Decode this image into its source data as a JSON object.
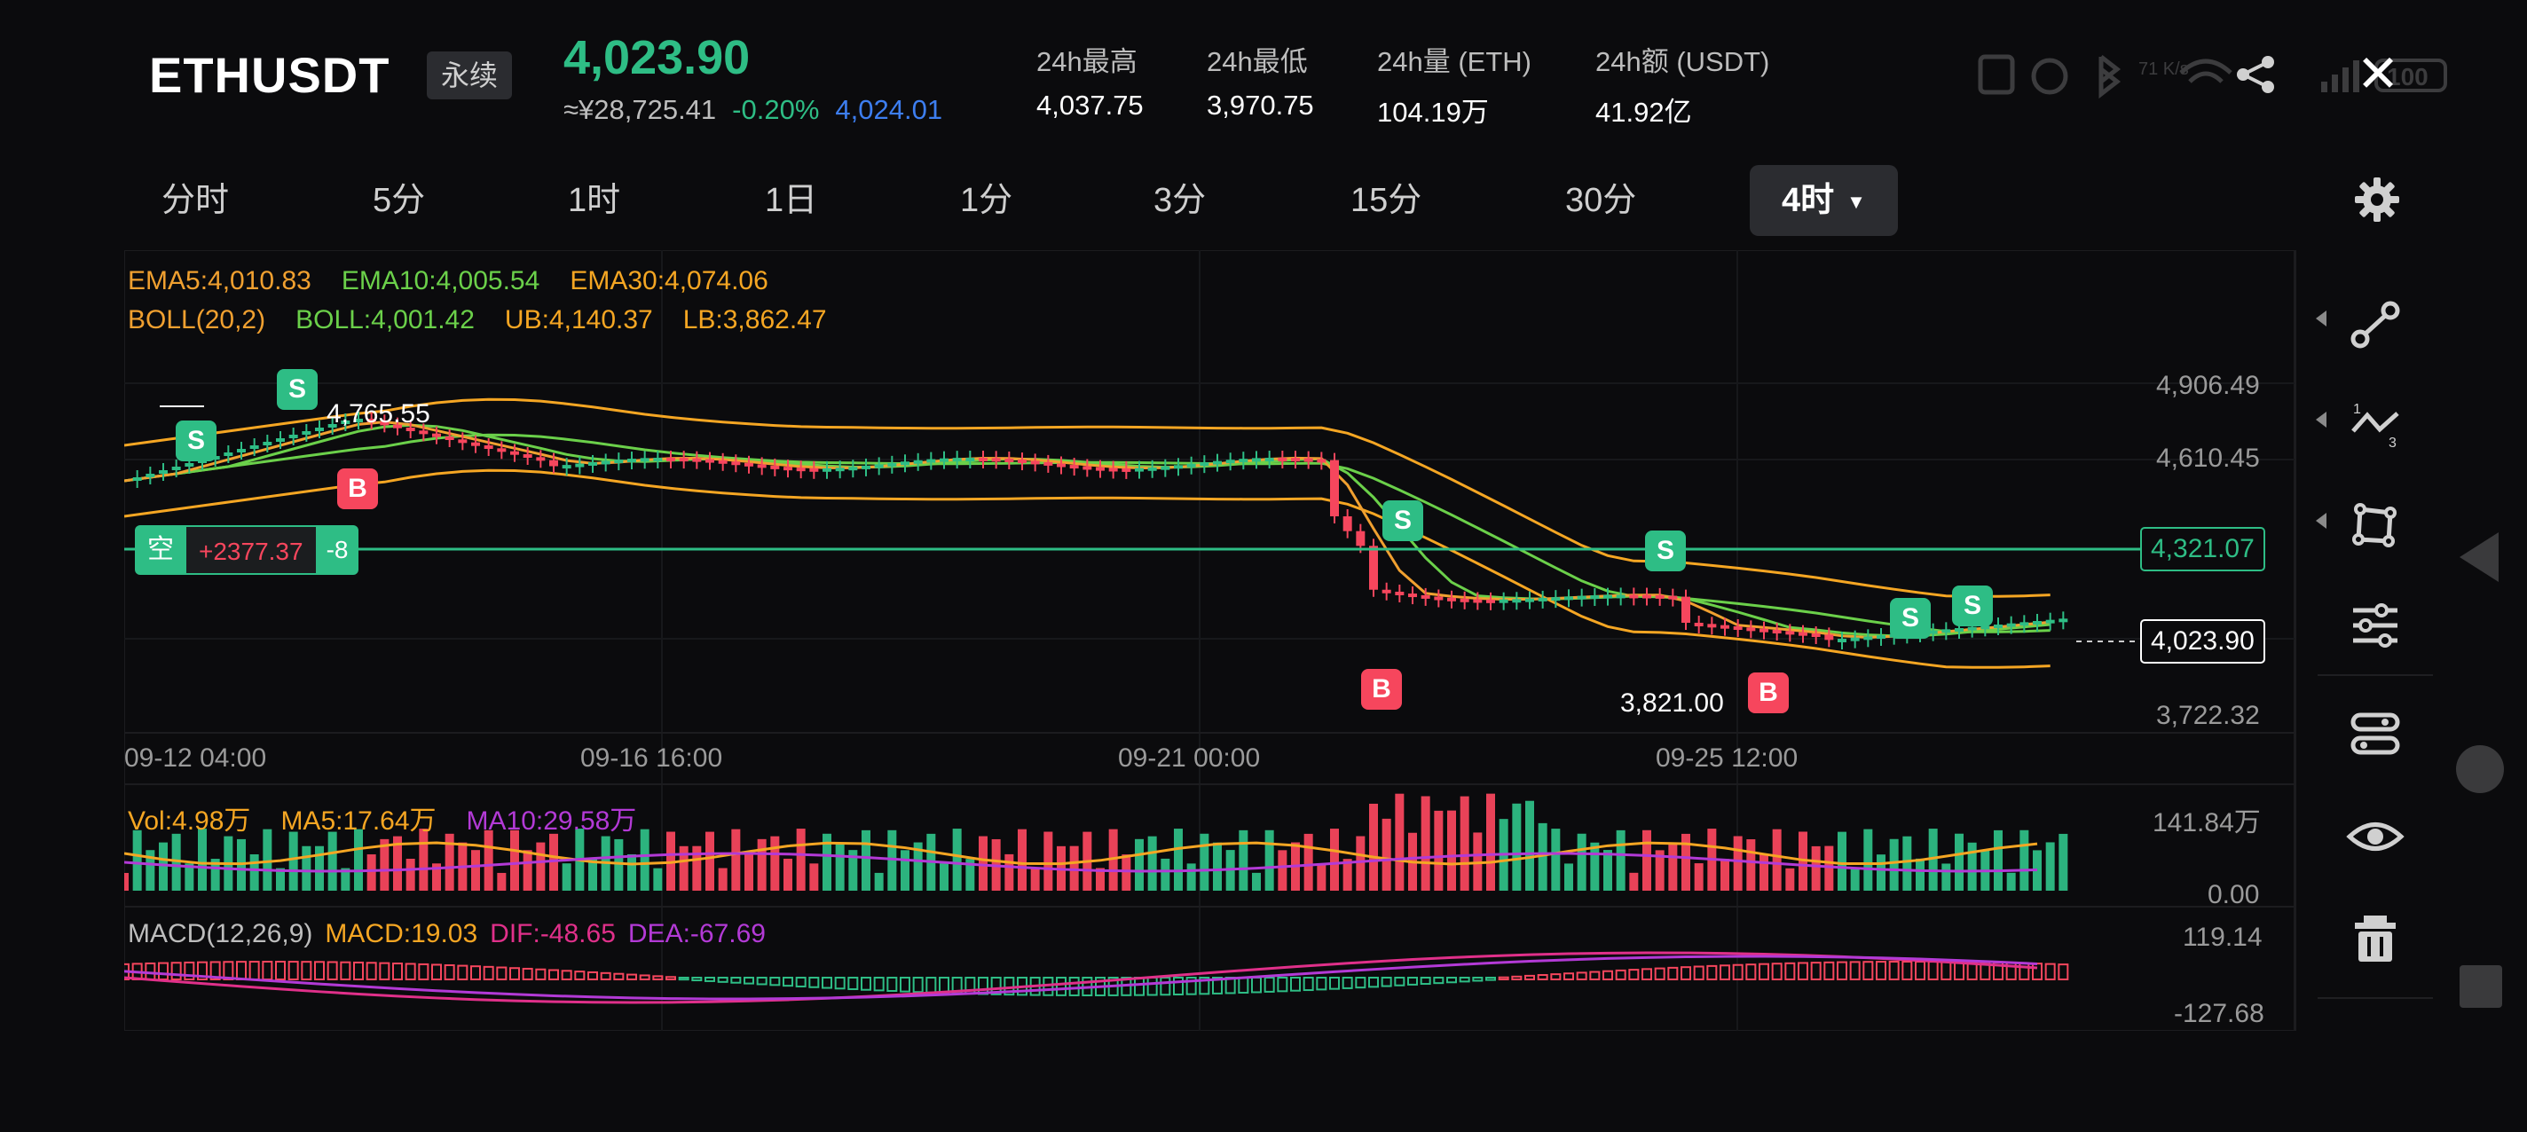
{
  "header": {
    "symbol": "ETHUSDT",
    "contract_type": "永续",
    "last_price": "4,023.90",
    "cny_price": "≈¥28,725.41",
    "change_pct": "-0.20%",
    "mark_price": "4,024.01",
    "stats": [
      {
        "label": "24h最高",
        "value": "4,037.75"
      },
      {
        "label": "24h最低",
        "value": "3,970.75"
      },
      {
        "label": "24h量 (ETH)",
        "value": "104.19万"
      },
      {
        "label": "24h额 (USDT)",
        "value": "41.92亿"
      }
    ],
    "status_icons": [
      "nfc-icon",
      "alarm-icon",
      "bluetooth-icon",
      "network-speed-icon",
      "wifi-icon",
      "signal-icon",
      "battery-icon"
    ],
    "network_speed": "71 K/s",
    "battery_level": "100"
  },
  "intervals": [
    {
      "label": "分时"
    },
    {
      "label": "5分"
    },
    {
      "label": "1时"
    },
    {
      "label": "1日"
    },
    {
      "label": "1分"
    },
    {
      "label": "3分"
    },
    {
      "label": "15分"
    },
    {
      "label": "30分"
    },
    {
      "label": "4时",
      "active": true
    }
  ],
  "legend": {
    "ema5": "EMA5:4,010.83",
    "ema10": "EMA10:4,005.54",
    "ema30": "EMA30:4,074.06",
    "boll_param": "BOLL(20,2)",
    "boll": "BOLL:4,001.42",
    "ub": "UB:4,140.37",
    "lb": "LB:3,862.47",
    "vol": "Vol:4.98万",
    "ma5": "MA5:17.64万",
    "ma10": "MA10:29.58万",
    "macd_param": "MACD(12,26,9)",
    "macd": "MACD:19.03",
    "dif": "DIF:-48.65",
    "dea": "DEA:-67.69"
  },
  "colors": {
    "up": "#2ebd85",
    "down": "#f6465d",
    "ema5": "#f0a030",
    "ema10": "#6bd04a",
    "ema30": "#f5a623",
    "vol_ma5": "#f5a623",
    "vol_ma10": "#b33ad6",
    "dif": "#e0308a",
    "dea": "#b33ad6"
  },
  "price_axis": [
    "4,906.49",
    "4,610.45",
    "3,722.32"
  ],
  "time_axis": [
    "09-12 04:00",
    "09-16 16:00",
    "09-21 00:00",
    "09-25 12:00"
  ],
  "vol_axis": [
    "141.84万",
    "0.00"
  ],
  "macd_axis": [
    "119.14",
    "-127.68"
  ],
  "annotations": {
    "high_label": "4,765.55",
    "low_label": "3,821.00",
    "position_side": "空",
    "position_pnl": "+2377.37",
    "position_qty": "-8",
    "position_price": "4,321.07",
    "last_price_tag": "4,023.90"
  },
  "signals": [
    {
      "type": "S"
    },
    {
      "type": "S"
    },
    {
      "type": "B"
    },
    {
      "type": "S"
    },
    {
      "type": "B"
    },
    {
      "type": "S"
    },
    {
      "type": "B"
    },
    {
      "type": "S"
    },
    {
      "type": "S"
    }
  ],
  "toolbar": [
    "trendline-icon",
    "line-tools-icon",
    "shape-icon",
    "indicator-settings-icon",
    "layout-toggle-icon",
    "visibility-icon",
    "delete-icon"
  ]
}
